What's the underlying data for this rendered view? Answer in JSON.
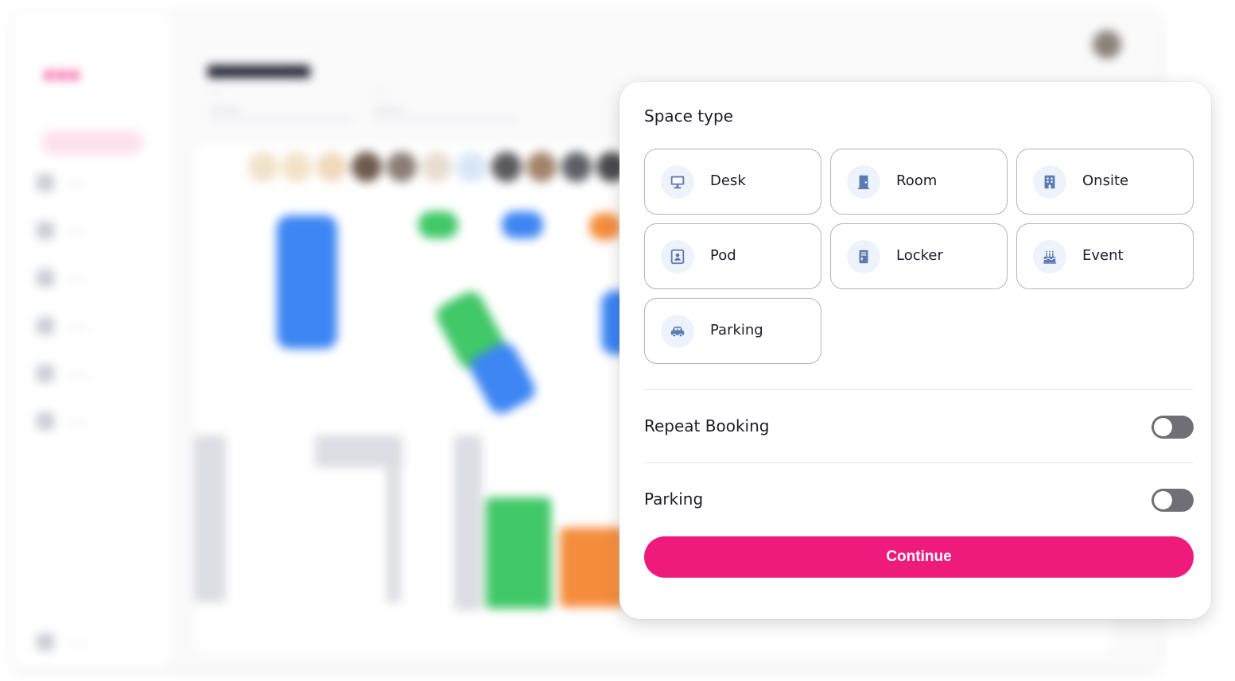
{
  "modal": {
    "section_title": "Space type",
    "space_types": [
      {
        "label": "Desk",
        "icon": "monitor-icon"
      },
      {
        "label": "Room",
        "icon": "door-icon"
      },
      {
        "label": "Onsite",
        "icon": "building-icon"
      },
      {
        "label": "Pod",
        "icon": "pod-icon"
      },
      {
        "label": "Locker",
        "icon": "locker-icon"
      },
      {
        "label": "Event",
        "icon": "cake-icon"
      },
      {
        "label": "Parking",
        "icon": "car-icon"
      }
    ],
    "repeat_booking": {
      "label": "Repeat Booking",
      "enabled": false
    },
    "parking": {
      "label": "Parking",
      "enabled": false
    },
    "continue_label": "Continue"
  },
  "colors": {
    "accent": "#ee1a7c",
    "icon_blue": "#5b7bb5",
    "toggle_off": "#6f6f75"
  }
}
